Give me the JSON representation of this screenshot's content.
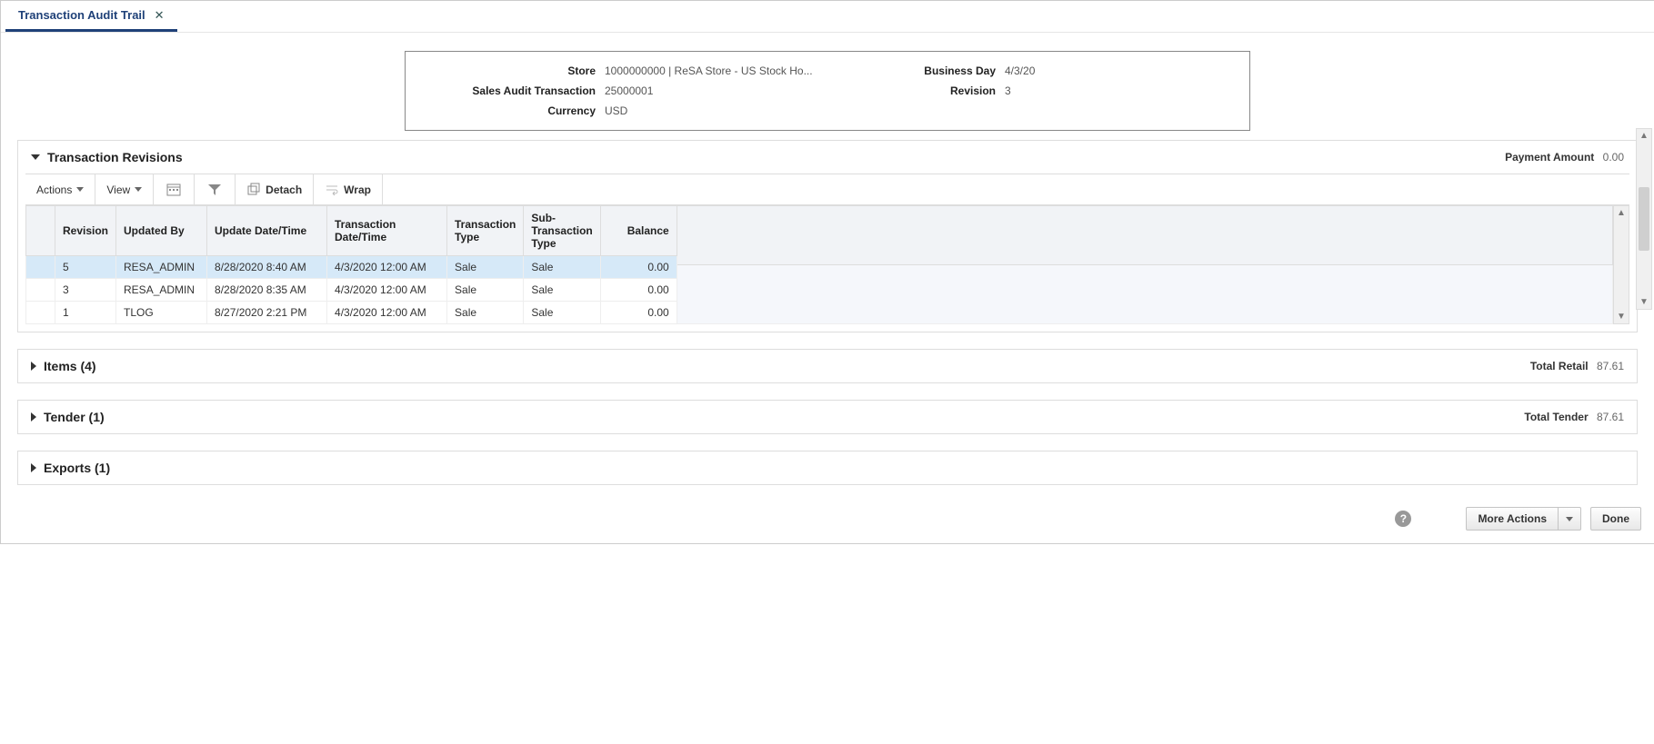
{
  "tab": {
    "title": "Transaction Audit Trail"
  },
  "summary": {
    "store_label": "Store",
    "store_value": "1000000000 | ReSA Store - US Stock Ho...",
    "sat_label": "Sales Audit Transaction",
    "sat_value": "25000001",
    "currency_label": "Currency",
    "currency_value": "USD",
    "bd_label": "Business Day",
    "bd_value": "4/3/20",
    "rev_label": "Revision",
    "rev_value": "3"
  },
  "revisions_panel": {
    "title": "Transaction Revisions",
    "payment_label": "Payment Amount",
    "payment_value": "0.00"
  },
  "toolbar": {
    "actions": "Actions",
    "view": "View",
    "detach": "Detach",
    "wrap": "Wrap"
  },
  "columns": {
    "revision": "Revision",
    "updated_by": "Updated By",
    "update_dt": "Update Date/Time",
    "txn_dt": "Transaction Date/Time",
    "txn_type": "Transaction Type",
    "sub_txn_type": "Sub-Transaction Type",
    "balance": "Balance"
  },
  "rows": [
    {
      "revision": "5",
      "updated_by": "RESA_ADMIN",
      "update_dt": "8/28/2020 8:40 AM",
      "txn_dt": "4/3/2020 12:00 AM",
      "txn_type": "Sale",
      "sub_txn_type": "Sale",
      "balance": "0.00",
      "selected": true
    },
    {
      "revision": "3",
      "updated_by": "RESA_ADMIN",
      "update_dt": "8/28/2020 8:35 AM",
      "txn_dt": "4/3/2020 12:00 AM",
      "txn_type": "Sale",
      "sub_txn_type": "Sale",
      "balance": "0.00",
      "selected": false
    },
    {
      "revision": "1",
      "updated_by": "TLOG",
      "update_dt": "8/27/2020 2:21 PM",
      "txn_dt": "4/3/2020 12:00 AM",
      "txn_type": "Sale",
      "sub_txn_type": "Sale",
      "balance": "0.00",
      "selected": false
    }
  ],
  "items_panel": {
    "title": "Items (4)",
    "right_label": "Total Retail",
    "right_value": "87.61"
  },
  "tender_panel": {
    "title": "Tender (1)",
    "right_label": "Total Tender",
    "right_value": "87.61"
  },
  "exports_panel": {
    "title": "Exports (1)"
  },
  "footer": {
    "more_actions": "More Actions",
    "done": "Done"
  }
}
